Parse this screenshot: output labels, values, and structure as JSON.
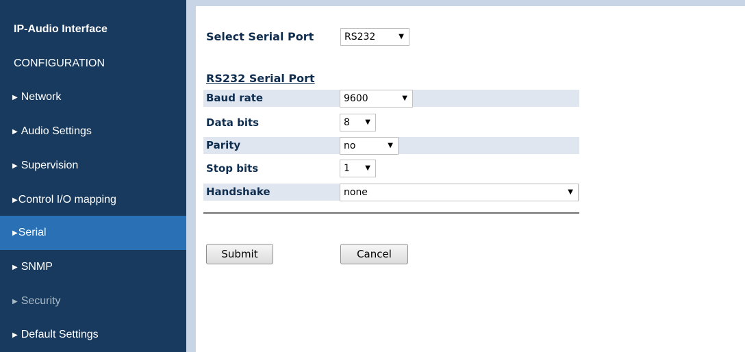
{
  "sidebar": {
    "title": "IP-Audio Interface",
    "section": "CONFIGURATION",
    "items": [
      {
        "label": "Network"
      },
      {
        "label": "Audio Settings"
      },
      {
        "label": "Supervision"
      },
      {
        "label": "Control I/O mapping"
      },
      {
        "label": "Serial",
        "state": "active"
      },
      {
        "label": "SNMP"
      },
      {
        "label": "Security",
        "state": "disabled"
      },
      {
        "label": "Default Settings"
      }
    ],
    "arrow_icon": "triangle-right-icon"
  },
  "colors": {
    "sidebar_bg": "#173a5e",
    "sidebar_active": "#2a70b4",
    "accent_strip": "#c7d5e6",
    "row_shade": "#dfe6f0",
    "label_text": "#0f2d4e"
  },
  "serial_port": {
    "label": "Select Serial Port",
    "value": "RS232"
  },
  "section": {
    "heading": "RS232 Serial Port",
    "fields": {
      "baud_rate": {
        "label": "Baud rate",
        "value": "9600"
      },
      "data_bits": {
        "label": "Data bits",
        "value": "8"
      },
      "parity": {
        "label": "Parity",
        "value": "no"
      },
      "stop_bits": {
        "label": "Stop bits",
        "value": "1"
      },
      "handshake": {
        "label": "Handshake",
        "value": "none"
      }
    }
  },
  "buttons": {
    "submit": "Submit",
    "cancel": "Cancel"
  }
}
